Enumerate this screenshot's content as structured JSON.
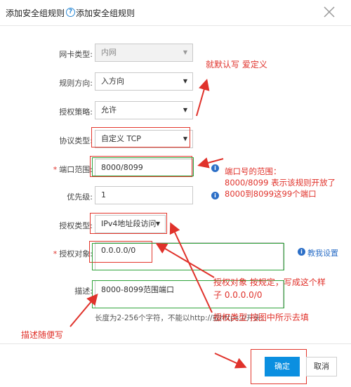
{
  "dialog": {
    "title": "添加安全组规则",
    "help_link": "添加安全组规则"
  },
  "form": {
    "nic_type": {
      "label": "网卡类型:",
      "value": "内网"
    },
    "direction": {
      "label": "规则方向:",
      "value": "入方向"
    },
    "policy": {
      "label": "授权策略:",
      "value": "允许"
    },
    "protocol": {
      "label": "协议类型:",
      "value": "自定义 TCP"
    },
    "port_range": {
      "label": "端口范围:",
      "value": "8000/8099"
    },
    "priority": {
      "label": "优先级:",
      "value": "1"
    },
    "auth_type": {
      "label": "授权类型:",
      "value": "IPv4地址段访问"
    },
    "auth_object": {
      "label": "授权对象:",
      "value": "0.0.0.0/0",
      "help": "教我设置"
    },
    "description": {
      "label": "描述:",
      "value": "8000-8099范围端口",
      "hint": "长度为2-256个字符，不能以http://或https://开头。"
    }
  },
  "annotations": {
    "default": "就默认写  爱定义",
    "port_note_1": "端口号的范围：",
    "port_note_2": "8000/8099 表示该规则开放了",
    "port_note_3": "8000到8099这99个端口",
    "auth_note_1": "授权对象  按规定，写成这个样",
    "auth_note_2": "子  0.0.0.0/0",
    "auth_type_note": "授权类型 按图中所示去填",
    "desc_note": "描述随便写",
    "color": "#e0322b"
  },
  "footer": {
    "ok": "确定",
    "cancel": "取消"
  },
  "colors": {
    "primary": "#0b8fe0",
    "link": "#2c6fc7",
    "required": "#e0322b",
    "annotation_red": "#e3372c",
    "annotation_green": "#2fa33a"
  }
}
